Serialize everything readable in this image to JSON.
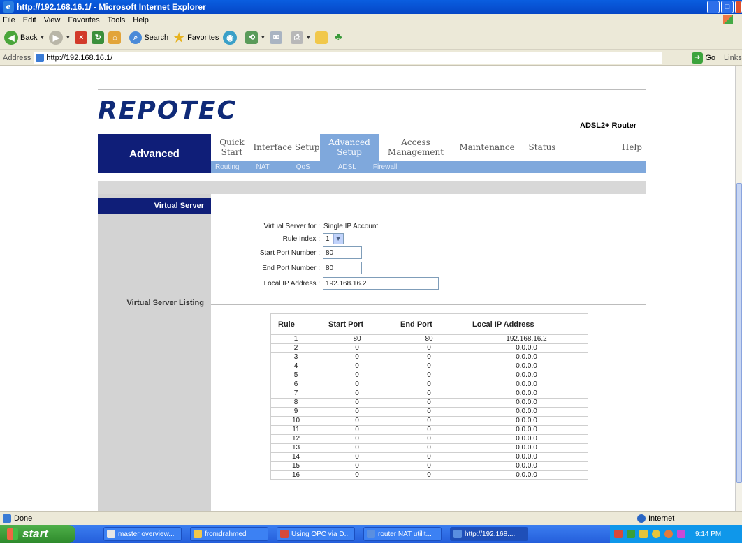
{
  "window": {
    "title": "http://192.168.16.1/ - Microsoft Internet Explorer",
    "buttons": {
      "minimize": "_",
      "maximize": "□",
      "close": "×"
    }
  },
  "menu": [
    "File",
    "Edit",
    "View",
    "Favorites",
    "Tools",
    "Help"
  ],
  "toolbar": {
    "back": "Back",
    "search": "Search",
    "favorites": "Favorites"
  },
  "address": {
    "label": "Address",
    "url": "http://192.168.16.1/",
    "go": "Go",
    "links": "Links"
  },
  "page": {
    "brand": "REPOTEC",
    "product": "ADSL2+ Router",
    "section_title": "Advanced",
    "tabs": [
      {
        "label": "Quick Start"
      },
      {
        "label": "Interface Setup"
      },
      {
        "label": "Advanced Setup",
        "active": true
      },
      {
        "label": "Access Management"
      },
      {
        "label": "Maintenance"
      },
      {
        "label": "Status"
      },
      {
        "label": "Help"
      }
    ],
    "subtabs": [
      "Routing",
      "NAT",
      "QoS",
      "ADSL",
      "Firewall"
    ],
    "sidebar": {
      "virtual_server": "Virtual Server",
      "listing": "Virtual Server Listing"
    },
    "form": {
      "virtual_server_for_label": "Virtual Server for :",
      "virtual_server_for_value": "Single IP Account",
      "rule_index_label": "Rule Index :",
      "rule_index_value": "1",
      "start_port_label": "Start Port Number :",
      "start_port_value": "80",
      "end_port_label": "End Port Number :",
      "end_port_value": "80",
      "local_ip_label": "Local IP Address :",
      "local_ip_value": "192.168.16.2"
    },
    "table": {
      "headers": [
        "Rule",
        "Start Port",
        "End Port",
        "Local IP Address"
      ],
      "rows": [
        [
          "1",
          "80",
          "80",
          "192.168.16.2"
        ],
        [
          "2",
          "0",
          "0",
          "0.0.0.0"
        ],
        [
          "3",
          "0",
          "0",
          "0.0.0.0"
        ],
        [
          "4",
          "0",
          "0",
          "0.0.0.0"
        ],
        [
          "5",
          "0",
          "0",
          "0.0.0.0"
        ],
        [
          "6",
          "0",
          "0",
          "0.0.0.0"
        ],
        [
          "7",
          "0",
          "0",
          "0.0.0.0"
        ],
        [
          "8",
          "0",
          "0",
          "0.0.0.0"
        ],
        [
          "9",
          "0",
          "0",
          "0.0.0.0"
        ],
        [
          "10",
          "0",
          "0",
          "0.0.0.0"
        ],
        [
          "11",
          "0",
          "0",
          "0.0.0.0"
        ],
        [
          "12",
          "0",
          "0",
          "0.0.0.0"
        ],
        [
          "13",
          "0",
          "0",
          "0.0.0.0"
        ],
        [
          "14",
          "0",
          "0",
          "0.0.0.0"
        ],
        [
          "15",
          "0",
          "0",
          "0.0.0.0"
        ],
        [
          "16",
          "0",
          "0",
          "0.0.0.0"
        ]
      ]
    }
  },
  "status": {
    "text": "Done",
    "zone": "Internet"
  },
  "taskbar": {
    "start": "start",
    "tasks": [
      {
        "label": "master overview..."
      },
      {
        "label": "fromdrahmed"
      },
      {
        "label": "Using OPC via D..."
      },
      {
        "label": "router NAT utilit..."
      },
      {
        "label": "http://192.168....",
        "active": true
      }
    ],
    "clock": "9:14 PM"
  },
  "colors": {
    "navy": "#0f1e78",
    "tab_blue": "#7fa8dc",
    "brand_blue": "#0f2a78",
    "sidebar_gray": "#d3d3d3"
  }
}
